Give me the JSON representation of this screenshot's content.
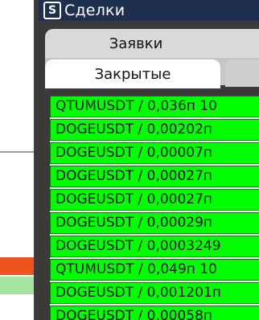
{
  "window": {
    "title": "Сделки",
    "icon": "app-logo-icon"
  },
  "tabs": {
    "orders_label": "Заявки",
    "closed_label": "Закрытые"
  },
  "trades": [
    "QTUMUSDT / 0,036п 10",
    "DOGEUSDT / 0,00202п",
    "DOGEUSDT / 0,00007п",
    "DOGEUSDT / 0,00027п",
    "DOGEUSDT / 0,00027п",
    "DOGEUSDT / 0,00029п",
    "DOGEUSDT / 0,0003249",
    "QTUMUSDT / 0,049п 10",
    "DOGEUSDT / 0,001201п",
    "DOGEUSDT / 0,00058п"
  ],
  "colors": {
    "titlebar": "#1e2f4f",
    "row_bg": "#00ff00",
    "bg_red": "#f0541e",
    "bg_green": "#a5e3a0"
  }
}
